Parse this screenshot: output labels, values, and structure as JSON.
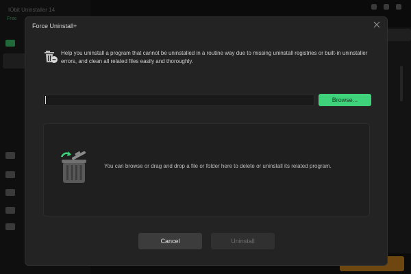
{
  "background_app": {
    "title": "IObit Uninstaller 14",
    "subtitle": "Free"
  },
  "dialog": {
    "title": "Force Uninstall+",
    "description": "Help you uninstall a program that cannot be uninstalled in a routine way due to missing uninstall registries or built-in uninstaller errors, and clean all related files easily and thoroughly.",
    "path_input": {
      "value": "",
      "placeholder": ""
    },
    "browse_label": "Browse...",
    "drop_text": "You can browse or drag and drop a file or folder here to delete or uninstall its related program.",
    "cancel_label": "Cancel",
    "uninstall_label": "Uninstall"
  },
  "icons": {
    "close": "close-icon",
    "info": "trash-info-icon",
    "drop": "recycle-bin-icon"
  },
  "colors": {
    "accent": "#3ed37a",
    "dialog_bg": "#232323",
    "orange": "#c8811e"
  }
}
